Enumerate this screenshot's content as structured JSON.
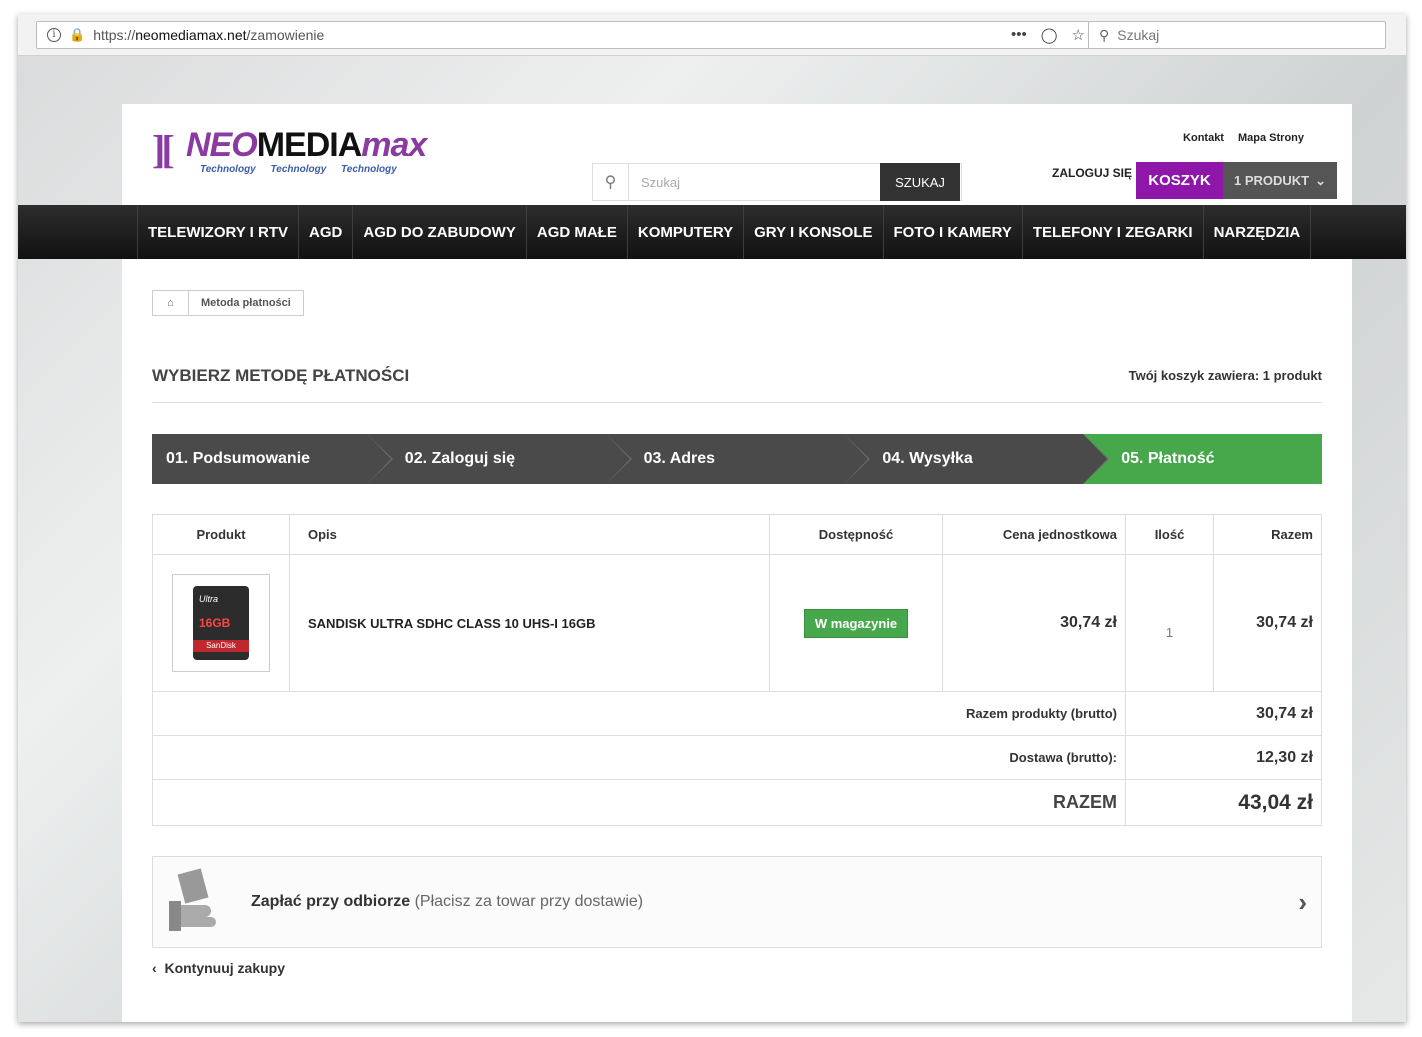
{
  "browser": {
    "url_prefix": "https://",
    "url_host": "neomediamax.net",
    "url_path": "/zamowienie",
    "search_placeholder": "Szukaj"
  },
  "logo": {
    "neo": "NEO",
    "media": "MEDIA",
    "max": "max",
    "tagline": "Technology Technology Technology"
  },
  "header": {
    "links": [
      "Kontakt",
      "Mapa Strony"
    ],
    "search_placeholder": "Szukaj",
    "search_button": "SZUKAJ",
    "login": "ZALOGUJ SIĘ",
    "cart": "KOSZYK",
    "cart_count": "1 PRODUKT"
  },
  "nav": [
    "TELEWIZORY I RTV",
    "AGD",
    "AGD DO ZABUDOWY",
    "AGD MAŁE",
    "KOMPUTERY",
    "GRY I KONSOLE",
    "FOTO I KAMERY",
    "TELEFONY I ZEGARKI",
    "NARZĘDZIA"
  ],
  "breadcrumb": "Metoda płatności",
  "page_title": "WYBIERZ METODĘ PŁATNOŚCI",
  "cart_info": "Twój koszyk zawiera: 1 produkt",
  "steps": [
    "01. Podsumowanie",
    "02. Zaloguj się",
    "03. Adres",
    "04. Wysyłka",
    "05. Płatność"
  ],
  "table": {
    "headers": [
      "Produkt",
      "Opis",
      "Dostępność",
      "Cena jednostkowa",
      "Ilość",
      "Razem"
    ],
    "product": {
      "name": "SANDISK ULTRA SDHC CLASS 10 UHS-I 16GB",
      "availability": "W magazynie",
      "unit_price": "30,74 zł",
      "qty": "1",
      "total": "30,74 zł",
      "img_brand": "Ultra",
      "img_size": "16GB",
      "img_maker": "SanDisk"
    },
    "subtotal_label": "Razem produkty (brutto)",
    "subtotal": "30,74 zł",
    "shipping_label": "Dostawa (brutto):",
    "shipping": "12,30 zł",
    "total_label": "RAZEM",
    "total": "43,04 zł"
  },
  "payment": {
    "title": "Zapłać przy odbiorze",
    "subtitle": "(Płacisz za towar przy dostawie)"
  },
  "continue": "Kontynuuj zakupy"
}
